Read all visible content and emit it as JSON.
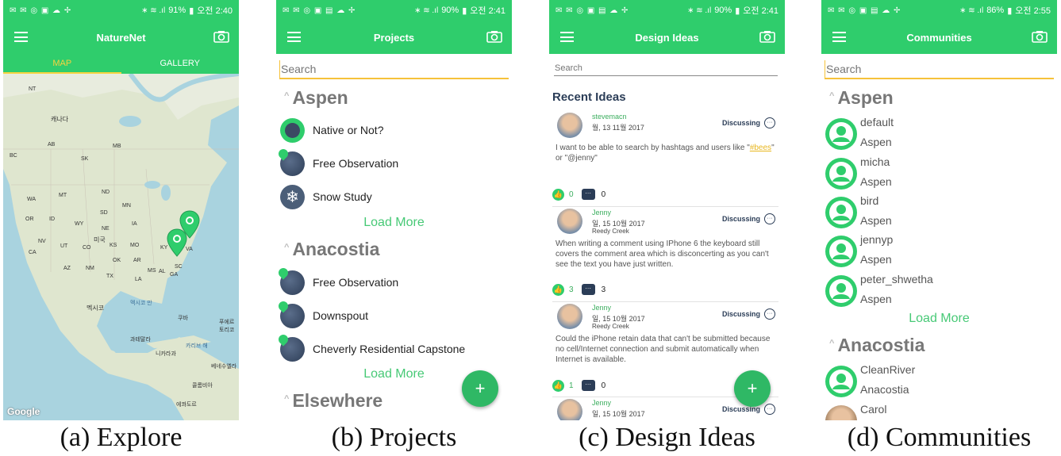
{
  "phones": {
    "explore": {
      "status": {
        "icons": "✉ ✉ ◎ ▣ ☁ ✢",
        "sys": "∗ ≋ .ıl",
        "battery": "91%",
        "time": "오전 2:40"
      },
      "title": "NatureNet",
      "tabs": [
        "MAP",
        "GALLERY"
      ],
      "map_labels": [
        "NT",
        "캐나다",
        "AB",
        "SK",
        "MB",
        "BC",
        "WA",
        "MT",
        "ND",
        "MN",
        "OR",
        "ID",
        "SD",
        "WY",
        "NE",
        "IA",
        "NV",
        "미국",
        "KS",
        "MO",
        "UT",
        "CO",
        "CA",
        "AZ",
        "NM",
        "OK",
        "AR",
        "TX",
        "LA",
        "MS",
        "AL",
        "GA",
        "SC",
        "KY",
        "VA",
        "멕시코",
        "멕시코 만",
        "쿠바",
        "과테말라",
        "니카라과",
        "카리브 해",
        "베네수엘라",
        "콜롬비아",
        "에콰도르",
        "푸에르토리코"
      ],
      "google": "Google"
    },
    "projects": {
      "status": {
        "icons": "✉ ✉ ◎ ▣ ▤ ☁ ✢",
        "sys": "∗ ≋ .ıl",
        "battery": "90%",
        "time": "오전 2:41"
      },
      "title": "Projects",
      "search_placeholder": "Search",
      "sections": [
        {
          "name": "Aspen",
          "items": [
            "Native or Not?",
            "Free Observation",
            "Snow Study"
          ]
        },
        {
          "name": "Anacostia",
          "items": [
            "Free Observation",
            "Downspout",
            "Cheverly Residential Capstone"
          ]
        },
        {
          "name": "Elsewhere",
          "items": []
        }
      ],
      "load_more": "Load More",
      "fab": "+"
    },
    "design_ideas": {
      "status": {
        "icons": "✉ ✉ ◎ ▣ ▤ ☁ ✢",
        "sys": "∗ ≋ .ıl",
        "battery": "90%",
        "time": "오전 2:41"
      },
      "title": "Design Ideas",
      "search_placeholder": "Search",
      "recent_title": "Recent Ideas",
      "ideas": [
        {
          "user": "stevemacn",
          "date": "월, 13 11월 2017",
          "location": "",
          "status": "Discussing",
          "body_pre": "I want to be able to search by hashtags and users like \"",
          "hashtag": "#bees",
          "body_post": "\" or \"@jenny\"",
          "likes": "0",
          "comments": "0"
        },
        {
          "user": "Jenny",
          "date": "일, 15 10월 2017",
          "location": "Reedy Creek",
          "status": "Discussing",
          "body": "When writing a comment using IPhone 6 the keyboard still covers the comment area which is disconcerting as you can't see the text you have just written.",
          "likes": "3",
          "comments": "3"
        },
        {
          "user": "Jenny",
          "date": "일, 15 10월 2017",
          "location": "Reedy Creek",
          "status": "Discussing",
          "body": "Could the iPhone retain data that can't be submitted because no cell/Internet connection and submit automatically when Internet is available.",
          "likes": "1",
          "comments": "0"
        },
        {
          "user": "Jenny",
          "date": "일, 15 10월 2017",
          "location": "",
          "status": "Discussing"
        }
      ],
      "fab": "+"
    },
    "communities": {
      "status": {
        "icons": "✉ ✉ ◎ ▣ ▤ ☁ ✢",
        "sys": "∗ ≋ .ıl",
        "battery": "86%",
        "time": "오전 2:55"
      },
      "title": "Communities",
      "search_placeholder": "Search",
      "sections": [
        {
          "name": "Aspen",
          "members": [
            {
              "name": "default",
              "community": "Aspen"
            },
            {
              "name": "micha",
              "community": "Aspen"
            },
            {
              "name": "bird",
              "community": "Aspen"
            },
            {
              "name": "jennyp",
              "community": "Aspen"
            },
            {
              "name": "peter_shwetha",
              "community": "Aspen"
            }
          ]
        },
        {
          "name": "Anacostia",
          "members": [
            {
              "name": "CleanRiver",
              "community": "Anacostia"
            },
            {
              "name": "Carol",
              "community": ""
            }
          ]
        }
      ],
      "load_more": "Load More"
    }
  },
  "captions": [
    "(a) Explore",
    "(b) Projects",
    "(c) Design Ideas",
    "(d) Communities"
  ],
  "colors": {
    "brand_green": "#2fcd6c",
    "tab_accent": "#f6d33f",
    "link_green": "#47c976",
    "navy": "#2b3d57"
  }
}
